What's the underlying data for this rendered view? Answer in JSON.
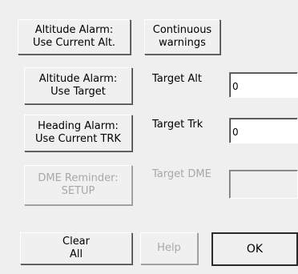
{
  "buttons": {
    "altitude_current": "Altitude Alarm:\nUse Current Alt.",
    "continuous_warnings": "Continuous\nwarnings",
    "altitude_target": "Altitude Alarm:\nUse Target",
    "heading_current": "Heading Alarm:\nUse Current TRK",
    "dme_reminder": "DME Reminder:\nSETUP",
    "clear_all": "Clear\nAll",
    "help": "Help",
    "ok": "OK"
  },
  "labels": {
    "target_alt": "Target Alt",
    "target_trk": "Target Trk",
    "target_dme": "Target DME"
  },
  "fields": {
    "target_alt_value": "0",
    "target_trk_value": "0",
    "target_dme_value": ""
  }
}
